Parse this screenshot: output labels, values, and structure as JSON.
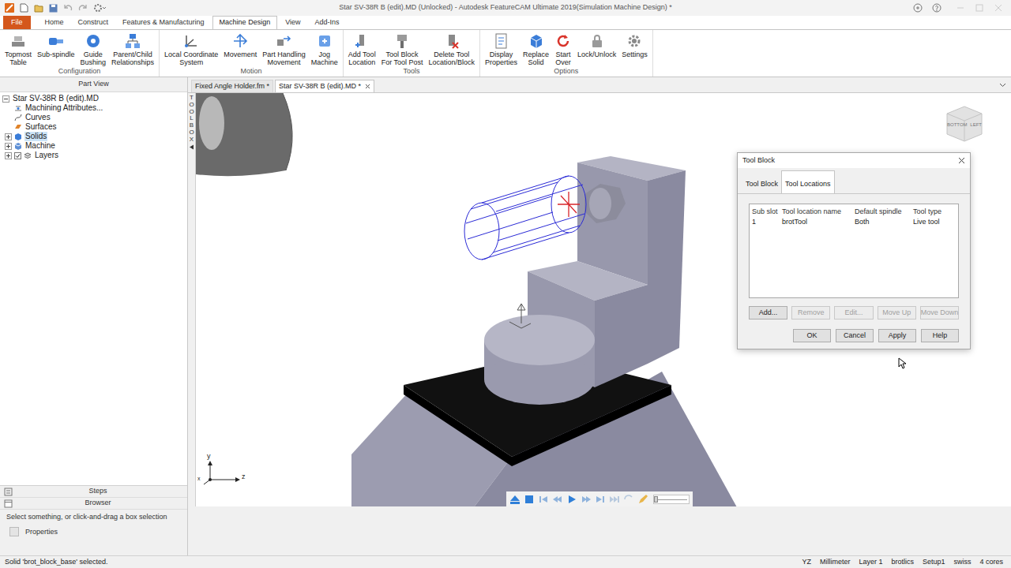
{
  "window": {
    "title": "Star SV-38R B (edit).MD (Unlocked) - Autodesk FeatureCAM Ultimate 2019(Simulation Machine Design) *"
  },
  "ribbon_tabs": [
    {
      "label": "File",
      "selected": false,
      "kind": "file"
    },
    {
      "label": "Home",
      "selected": false,
      "kind": "tab"
    },
    {
      "label": "Construct",
      "selected": false,
      "kind": "tab"
    },
    {
      "label": "Features & Manufacturing",
      "selected": false,
      "kind": "tab"
    },
    {
      "label": "Machine Design",
      "selected": true,
      "kind": "tab"
    },
    {
      "label": "View",
      "selected": false,
      "kind": "tab"
    },
    {
      "label": "Add-Ins",
      "selected": false,
      "kind": "tab"
    }
  ],
  "ribbon_groups": [
    {
      "label": "Configuration",
      "buttons": [
        {
          "lines": [
            "Topmost",
            "Table"
          ]
        },
        {
          "lines": [
            "Sub-spindle"
          ]
        },
        {
          "lines": [
            "Guide",
            "Bushing"
          ]
        },
        {
          "lines": [
            "Parent/Child",
            "Relationships"
          ]
        }
      ]
    },
    {
      "label": "Motion",
      "buttons": [
        {
          "lines": [
            "Local Coordinate",
            "System"
          ]
        },
        {
          "lines": [
            "Movement"
          ]
        },
        {
          "lines": [
            "Part Handling",
            "Movement"
          ]
        },
        {
          "lines": [
            "Jog",
            "Machine"
          ]
        }
      ]
    },
    {
      "label": "Tools",
      "buttons": [
        {
          "lines": [
            "Add Tool",
            "Location"
          ]
        },
        {
          "lines": [
            "Tool Block",
            "For Tool Post"
          ]
        },
        {
          "lines": [
            "Delete Tool",
            "Location/Block"
          ]
        }
      ]
    },
    {
      "label": "Options",
      "buttons": [
        {
          "lines": [
            "Display",
            "Properties"
          ]
        },
        {
          "lines": [
            "Replace",
            "Solid"
          ]
        },
        {
          "lines": [
            "Start",
            "Over"
          ]
        },
        {
          "lines": [
            "Lock/Unlock"
          ]
        },
        {
          "lines": [
            "Settings"
          ]
        }
      ]
    }
  ],
  "part_view": {
    "title": "Part View",
    "tree": {
      "label": "Star SV-38R B (edit).MD",
      "selected": false,
      "expanded": true,
      "children": [
        {
          "label": "Machining Attributes...",
          "selected": false
        },
        {
          "label": "Curves",
          "selected": false
        },
        {
          "label": "Surfaces",
          "selected": false
        },
        {
          "label": "Solids",
          "selected": true,
          "expanded": false
        },
        {
          "label": "Machine",
          "selected": false,
          "expanded": false
        },
        {
          "label": "Layers",
          "selected": false,
          "expanded": false,
          "checked": true
        }
      ]
    }
  },
  "document_tabs": [
    {
      "label": "Fixed Angle Holder.fm *",
      "selected": false
    },
    {
      "label": "Star SV-38R B (edit).MD *",
      "selected": true
    }
  ],
  "toolbox": {
    "label": "TOOLBOX"
  },
  "view_cube": {
    "faces": [
      "BOTTOM",
      "LEFT"
    ]
  },
  "axes": {
    "x": "x",
    "y": "y",
    "z": "z"
  },
  "playback": {
    "slider": {
      "level": 0
    }
  },
  "bottom_panel": {
    "tabs": [
      "Steps",
      "Browser"
    ],
    "hint": "Select something, or click-and-drag a box selection",
    "properties": "Properties"
  },
  "dialog": {
    "title": "Tool Block",
    "tabs": [
      {
        "label": "Tool Block",
        "selected": false
      },
      {
        "label": "Tool Locations",
        "selected": true
      }
    ],
    "table": {
      "columns": [
        "Sub slot",
        "Tool location name",
        "Default spindle",
        "Tool type"
      ],
      "rows": [
        {
          "cells": [
            "1",
            "brotTool",
            "Both",
            "Live tool"
          ],
          "selected": false
        }
      ]
    },
    "actions": [
      {
        "label": "Add...",
        "disabled": false
      },
      {
        "label": "Remove",
        "disabled": true
      },
      {
        "label": "Edit...",
        "disabled": true
      },
      {
        "label": "Move Up",
        "disabled": true
      },
      {
        "label": "Move Down",
        "disabled": true
      }
    ],
    "buttons": [
      "OK",
      "Cancel",
      "Apply",
      "Help"
    ]
  },
  "status_bar": {
    "message": "Solid 'brot_block_base' selected.",
    "items": [
      "YZ",
      "Millimeter",
      "Layer 1",
      "brotlics",
      "Setup1",
      "swiss",
      "4 cores"
    ]
  }
}
